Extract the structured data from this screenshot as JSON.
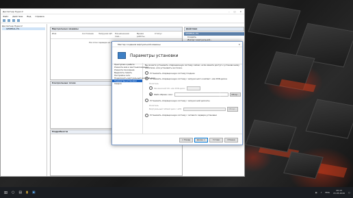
{
  "manager": {
    "title": "Диспетчер Hyper-V",
    "menu": [
      "Файл",
      "Действие",
      "Вид",
      "Справка"
    ],
    "tree": [
      "Диспетчер Hyper-V",
      "GENERAL-HS"
    ],
    "vm_panel": {
      "title": "Виртуальные машины",
      "columns": [
        "Имя",
        "Состояние",
        "Загрузка ЦП",
        "Назначенная пам...",
        "Время работы",
        "Статус"
      ],
      "empty_text": "На этом сервере не найдено виртуальных машин."
    },
    "checkpoints_panel": {
      "title": "Контрольные точки"
    },
    "details_panel": {
      "title": "Подробности"
    },
    "actions": {
      "title": "Действия",
      "section": "GENERAL-HS",
      "items": [
        "Создать",
        "Импорт виртуальной...",
        "Параметры Hyper-V...",
        "Диспетчер виртуал...",
        "Диспетчер виртуал...",
        "Изменить диск...",
        "Проверить диск...",
        "Остановить службу",
        "Удалить сервер",
        "Обновить",
        "Вид",
        "Справка"
      ]
    }
  },
  "wizard": {
    "title": "Мастер создания виртуальной машины",
    "heading": "Параметры установки",
    "steps": [
      "Приступая к работе",
      "Укажите имя и местонахождение",
      "Укажите поколение",
      "Выделить память",
      "Настройка сети",
      "Подключить виртуальный жесткий диск",
      "Параметры установки",
      "Сводка"
    ],
    "current_step": 6,
    "intro": "Вы можете установить операционную систему сейчас, если имеете доступ к установочному носителю, или установить ее позже.",
    "options": [
      "Установить операционную систему позднее",
      "Установить операционную систему с загрузочного компакт- или DVD-диска",
      "Установить операционную систему с загрузочной дискеты",
      "Установить операционную систему с сетевого сервера установки"
    ],
    "selected_option": 1,
    "media_label": "Носитель",
    "physical_drive": "Физический CD- или DVD-диск:",
    "image_file": "Файл образа (.iso):",
    "media_label2": "Носитель",
    "floppy_label": "Виртуальный гибкий диск (.vfd):",
    "browse": "Обзор...",
    "buttons": {
      "prev": "< Назад",
      "next": "Далее >",
      "finish": "Готово",
      "cancel": "Отмена"
    }
  },
  "taskbar": {
    "lang": "ENG",
    "time": "20:13",
    "date": "15.05.2020"
  }
}
